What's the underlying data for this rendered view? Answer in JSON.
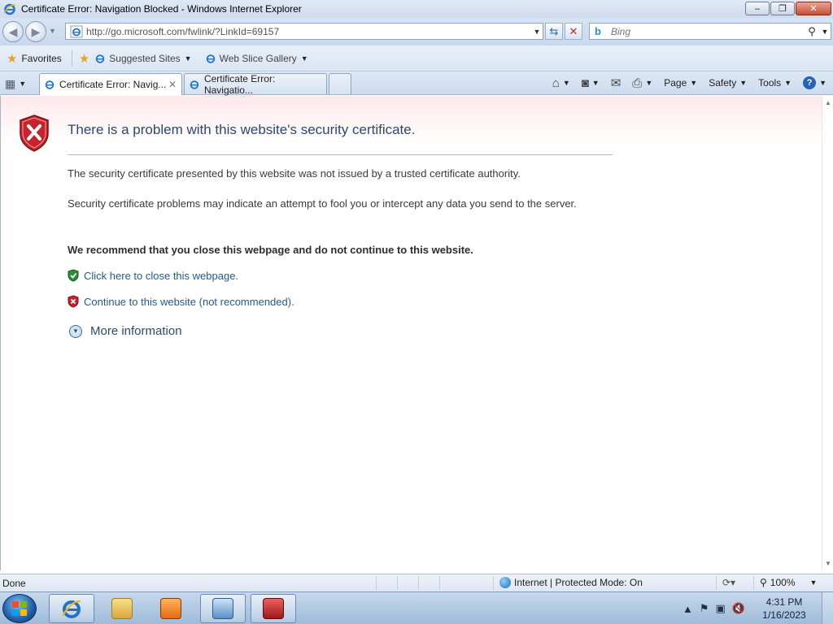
{
  "window": {
    "title": "Certificate Error: Navigation Blocked - Windows Internet Explorer",
    "minimize": "–",
    "maximize": "❐",
    "close": "✕"
  },
  "nav": {
    "address": "http://go.microsoft.com/fwlink/?LinkId=69157",
    "search_placeholder": "Bing"
  },
  "favorites_bar": {
    "favorites_label": "Favorites",
    "items": [
      {
        "label": "Suggested Sites"
      },
      {
        "label": "Web Slice Gallery"
      }
    ]
  },
  "tabs": [
    {
      "label": "Certificate Error: Navig...",
      "active": true
    },
    {
      "label": "Certificate Error: Navigatio...",
      "active": false
    }
  ],
  "commands": {
    "page": "Page",
    "safety": "Safety",
    "tools": "Tools",
    "help": "?"
  },
  "page": {
    "heading": "There is a problem with this website's security certificate.",
    "para1": "The security certificate presented by this website was not issued by a trusted certificate authority.",
    "para2": "Security certificate problems may indicate an attempt to fool you or intercept any data you send to the server.",
    "recommend": "We recommend that you close this webpage and do not continue to this website.",
    "close_link": "Click here to close this webpage.",
    "continue_link": "Continue to this website (not recommended).",
    "more_info": "More information"
  },
  "status": {
    "text": "Done",
    "zone": "Internet | Protected Mode: On",
    "zoom": "100%"
  },
  "taskbar": {
    "time": "4:31 PM",
    "date": "1/16/2023"
  },
  "colors": {
    "link": "#1f5a94",
    "heading": "#2b4a6e",
    "error_red": "#c8232c",
    "safe_green": "#2e8b3a"
  }
}
